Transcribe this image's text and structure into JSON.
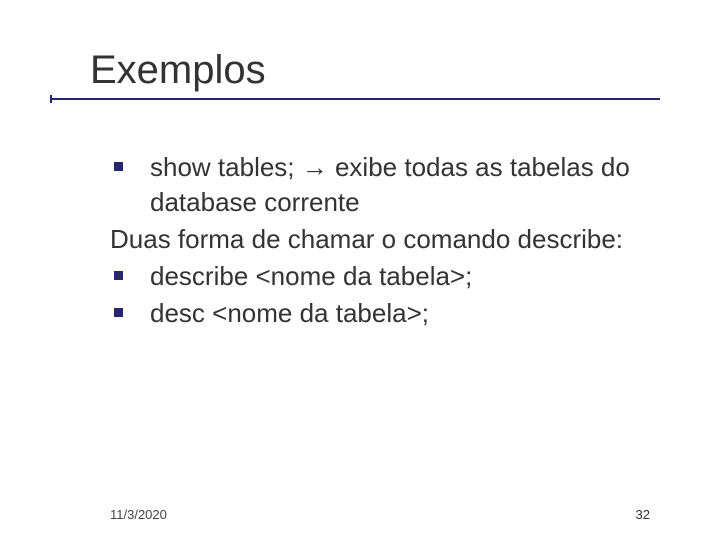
{
  "slide": {
    "title": "Exemplos",
    "paragraphs": [
      {
        "type": "bullet",
        "text": "show tables; → exibe todas as tabelas do database corrente"
      },
      {
        "type": "plain",
        "text": "Duas forma de chamar o comando describe:"
      },
      {
        "type": "bullet",
        "text": "describe <nome da tabela>;"
      },
      {
        "type": "bullet",
        "text": "desc <nome da tabela>;"
      }
    ]
  },
  "footer": {
    "date": "11/3/2020",
    "page": "32"
  }
}
